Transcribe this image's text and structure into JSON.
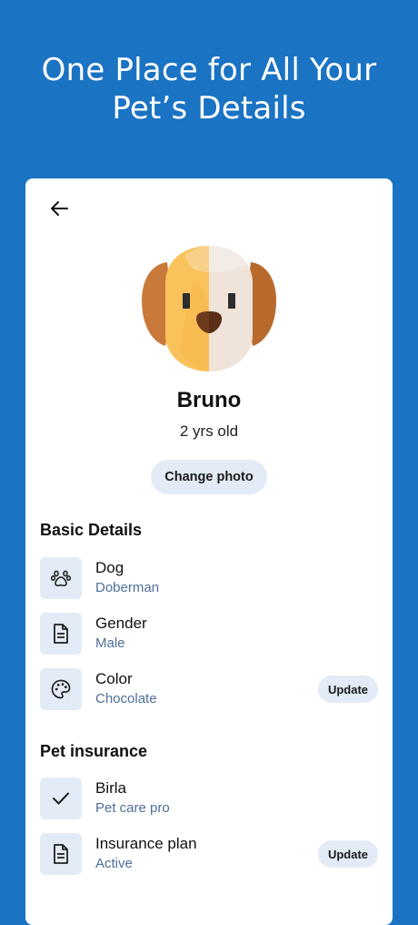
{
  "headline": {
    "line1": "One Place for All Your",
    "line2": "Pet’s Details"
  },
  "profile": {
    "name": "Bruno",
    "age": "2 yrs old",
    "change_photo_label": "Change photo",
    "avatar_icon": "dog-face-icon"
  },
  "basic_details": {
    "title": "Basic Details",
    "items": [
      {
        "title": "Dog",
        "subtitle": "Doberman",
        "icon": "paw-icon"
      },
      {
        "title": "Gender",
        "subtitle": "Male",
        "icon": "document-icon"
      },
      {
        "title": "Color",
        "subtitle": "Chocolate",
        "icon": "palette-icon",
        "action": "Update"
      }
    ]
  },
  "pet_insurance": {
    "title": "Pet insurance",
    "items": [
      {
        "title": "Birla",
        "subtitle": "Pet care pro",
        "icon": "check-icon"
      },
      {
        "title": "Insurance plan",
        "subtitle": "Active",
        "icon": "document-icon",
        "action": "Update"
      }
    ]
  },
  "colors": {
    "background": "#1a73c3",
    "card": "#ffffff",
    "chip": "#e3ebf6",
    "subtitle": "#4d6f99"
  }
}
